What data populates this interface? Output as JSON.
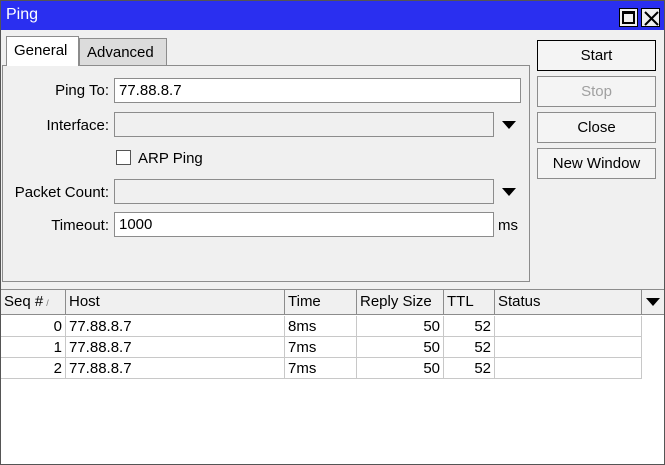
{
  "window": {
    "title": "Ping"
  },
  "tabs": [
    {
      "label": "General",
      "active": true
    },
    {
      "label": "Advanced",
      "active": false
    }
  ],
  "form": {
    "ping_to": {
      "label": "Ping To:",
      "value": "77.88.8.7"
    },
    "interface": {
      "label": "Interface:",
      "value": ""
    },
    "arp_ping": {
      "label": "ARP Ping",
      "checked": false
    },
    "packet_count": {
      "label": "Packet Count:",
      "value": ""
    },
    "timeout": {
      "label": "Timeout:",
      "value": "1000",
      "unit": "ms"
    }
  },
  "buttons": {
    "start": "Start",
    "stop": "Stop",
    "close": "Close",
    "new_window": "New Window"
  },
  "table": {
    "columns": [
      "Seq #",
      "Host",
      "Time",
      "Reply Size",
      "TTL",
      "Status"
    ],
    "sort_indicator": "/",
    "rows": [
      {
        "seq": "0",
        "host": "77.88.8.7",
        "time": "8ms",
        "reply_size": "50",
        "ttl": "52",
        "status": ""
      },
      {
        "seq": "1",
        "host": "77.88.8.7",
        "time": "7ms",
        "reply_size": "50",
        "ttl": "52",
        "status": ""
      },
      {
        "seq": "2",
        "host": "77.88.8.7",
        "time": "7ms",
        "reply_size": "50",
        "ttl": "52",
        "status": ""
      }
    ]
  },
  "colors": {
    "titlebar": "#2a2ff0",
    "background": "#f0f0f0"
  },
  "icons": [
    "restore-icon",
    "close-icon",
    "dropdown-arrow-icon"
  ]
}
